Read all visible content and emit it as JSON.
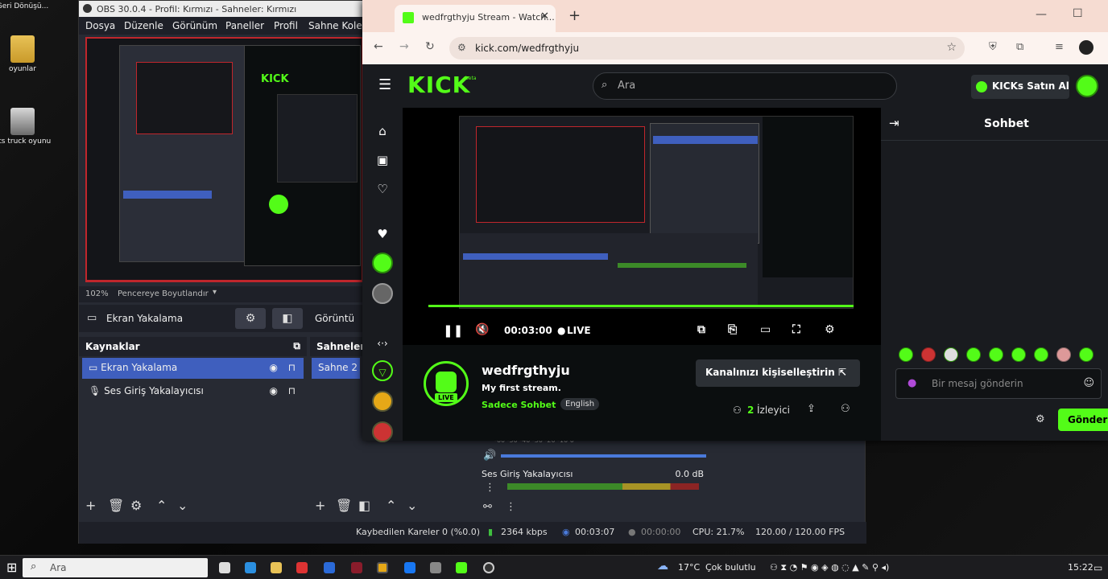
{
  "desktop": {
    "icons": [
      {
        "label": "Geri Dönüşü..."
      },
      {
        "label": "oyunlar"
      },
      {
        "label": "ets truck oyunu"
      }
    ]
  },
  "obs": {
    "window_title": "OBS 30.0.4 - Profil: Kırmızı - Sahneler: Kırmızı",
    "menu": [
      "Dosya",
      "Düzenle",
      "Görünüm",
      "Paneller",
      "Profil",
      "Sahne Koleks"
    ],
    "zoom": "102%",
    "fit_mode": "Pencereye Boyutlandır",
    "selected_source_label": "Ekran Yakalama",
    "sources_header": "Kaynaklar",
    "scenes_header": "Sahneler",
    "sources": [
      {
        "name": "Ekran Yakalama",
        "selected": true
      },
      {
        "name": "Ses Giriş Yakalayıcısı",
        "selected": false
      }
    ],
    "scenes": [
      {
        "name": "Sahne 2",
        "selected": true
      }
    ],
    "mixer_device": "Ses Giriş Yakalayıcısı",
    "mixer_level": "0.0 dB",
    "mixer_scale": [
      "-60",
      "-55",
      "-50",
      "-45",
      "-40",
      "-35",
      "-30",
      "-25",
      "-20",
      "-15",
      "-10",
      "-5",
      "0"
    ],
    "toolbar_button": "Görüntü",
    "status": {
      "dropped_frames": "Kaybedilen Kareler 0 (%0.0)",
      "bitrate": "2364 kbps",
      "stream_time": "00:03:07",
      "rec_time": "00:00:00",
      "cpu": "CPU: 21.7%",
      "fps": "120.00 / 120.00 FPS"
    }
  },
  "browser": {
    "tab_title": "wedfrgthyju Stream - Watch...",
    "url": "kick.com/wedfrgthyju",
    "accent": "#53fc18"
  },
  "kick": {
    "logo": "KICK",
    "logo_badge": "beta",
    "search_placeholder": "Ara",
    "buy_kicks": "KICKs Satın Al",
    "chat_title": "Sohbet",
    "chat_placeholder": "Bir mesaj gönderin",
    "send_button": "Gönder",
    "player": {
      "time": "00:03:00",
      "live_label": "LIVE"
    },
    "channel": {
      "name": "wedfrgthyju",
      "stream_title": "My first stream.",
      "category": "Sadece Sohbet",
      "tag": "English",
      "live_badge": "LIVE",
      "viewers_count": "2",
      "viewers_label": "İzleyici",
      "customize_button": "Kanalınızı kişiselleştirin"
    }
  },
  "taskbar": {
    "search_placeholder": "Ara",
    "weather": "17°C",
    "weather_desc": "Çok bulutlu",
    "time": "15:22"
  }
}
